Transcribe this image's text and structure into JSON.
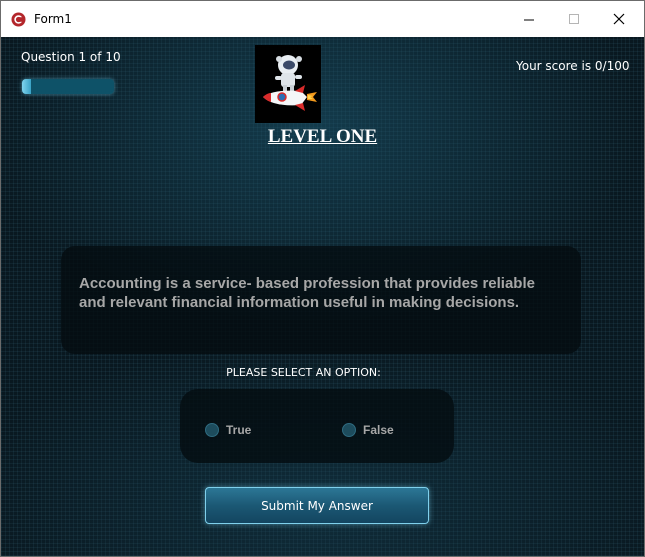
{
  "window": {
    "title": "Form1",
    "accent": "#b3262b"
  },
  "quiz": {
    "question_counter": "Question 1 of 10",
    "progress": 0.1,
    "score_text": "Your score is 0/100",
    "level_title": "LEVEL ONE",
    "logo": "astronaut-on-rocket",
    "question": "Accounting is a service- based profession that provides reliable and relevant financial information useful in making decisions.",
    "prompt": "PLEASE SELECT AN OPTION:",
    "options": [
      "True",
      "False"
    ],
    "submit_label": "Submit My Answer"
  }
}
